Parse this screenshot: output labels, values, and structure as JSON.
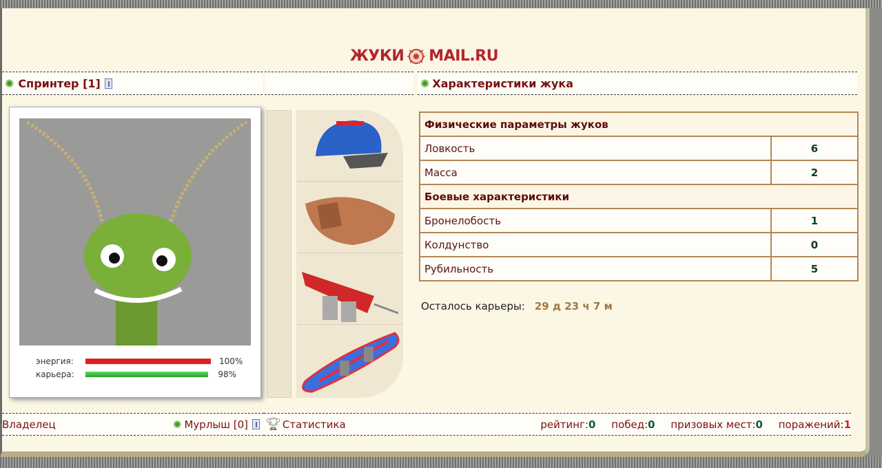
{
  "logo": {
    "left": "ЖУКИ",
    "right": "MAIL.RU"
  },
  "bug": {
    "name": "Спринтер [1]",
    "energy_label": "энергия:",
    "energy_pct": "100%",
    "energy_value": 100,
    "career_label": "карьера:",
    "career_pct": "98%",
    "career_value": 98
  },
  "items": [
    "helmet",
    "armor-shell",
    "rocket-booster",
    "snowboard"
  ],
  "stats": {
    "title": "Характеристики жука",
    "section1": "Физические параметры жуков",
    "rows1": [
      {
        "label": "Ловкость",
        "value": "6"
      },
      {
        "label": "Масса",
        "value": "2"
      }
    ],
    "section2": "Боевые характеристики",
    "rows2": [
      {
        "label": "Бронелобость",
        "value": "1"
      },
      {
        "label": "Колдунство",
        "value": "0"
      },
      {
        "label": "Рубильность",
        "value": "5"
      }
    ],
    "career_label": "Осталось карьеры:",
    "career_value": "29 д 23 ч 7 м"
  },
  "footer": {
    "owner_label": "Владелец",
    "owner_name": "Мурлыш [0]",
    "stats_link": "Статистика",
    "rating_label": "рейтинг:",
    "rating": "0",
    "wins_label": "побед:",
    "wins": "0",
    "prizes_label": "призовых мест:",
    "prizes": "0",
    "losses_label": "поражений:",
    "losses": "1"
  },
  "colors": {
    "energy": "#e02020",
    "career": "#3fcf3f",
    "accent": "#7a1010"
  }
}
